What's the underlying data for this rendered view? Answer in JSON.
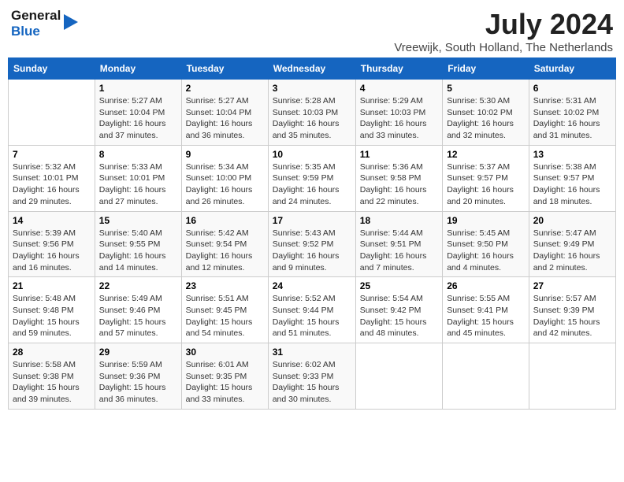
{
  "header": {
    "logo_line1": "General",
    "logo_line2": "Blue",
    "month": "July 2024",
    "location": "Vreewijk, South Holland, The Netherlands"
  },
  "days_of_week": [
    "Sunday",
    "Monday",
    "Tuesday",
    "Wednesday",
    "Thursday",
    "Friday",
    "Saturday"
  ],
  "weeks": [
    [
      {
        "num": "",
        "info": ""
      },
      {
        "num": "1",
        "info": "Sunrise: 5:27 AM\nSunset: 10:04 PM\nDaylight: 16 hours\nand 37 minutes."
      },
      {
        "num": "2",
        "info": "Sunrise: 5:27 AM\nSunset: 10:04 PM\nDaylight: 16 hours\nand 36 minutes."
      },
      {
        "num": "3",
        "info": "Sunrise: 5:28 AM\nSunset: 10:03 PM\nDaylight: 16 hours\nand 35 minutes."
      },
      {
        "num": "4",
        "info": "Sunrise: 5:29 AM\nSunset: 10:03 PM\nDaylight: 16 hours\nand 33 minutes."
      },
      {
        "num": "5",
        "info": "Sunrise: 5:30 AM\nSunset: 10:02 PM\nDaylight: 16 hours\nand 32 minutes."
      },
      {
        "num": "6",
        "info": "Sunrise: 5:31 AM\nSunset: 10:02 PM\nDaylight: 16 hours\nand 31 minutes."
      }
    ],
    [
      {
        "num": "7",
        "info": "Sunrise: 5:32 AM\nSunset: 10:01 PM\nDaylight: 16 hours\nand 29 minutes."
      },
      {
        "num": "8",
        "info": "Sunrise: 5:33 AM\nSunset: 10:01 PM\nDaylight: 16 hours\nand 27 minutes."
      },
      {
        "num": "9",
        "info": "Sunrise: 5:34 AM\nSunset: 10:00 PM\nDaylight: 16 hours\nand 26 minutes."
      },
      {
        "num": "10",
        "info": "Sunrise: 5:35 AM\nSunset: 9:59 PM\nDaylight: 16 hours\nand 24 minutes."
      },
      {
        "num": "11",
        "info": "Sunrise: 5:36 AM\nSunset: 9:58 PM\nDaylight: 16 hours\nand 22 minutes."
      },
      {
        "num": "12",
        "info": "Sunrise: 5:37 AM\nSunset: 9:57 PM\nDaylight: 16 hours\nand 20 minutes."
      },
      {
        "num": "13",
        "info": "Sunrise: 5:38 AM\nSunset: 9:57 PM\nDaylight: 16 hours\nand 18 minutes."
      }
    ],
    [
      {
        "num": "14",
        "info": "Sunrise: 5:39 AM\nSunset: 9:56 PM\nDaylight: 16 hours\nand 16 minutes."
      },
      {
        "num": "15",
        "info": "Sunrise: 5:40 AM\nSunset: 9:55 PM\nDaylight: 16 hours\nand 14 minutes."
      },
      {
        "num": "16",
        "info": "Sunrise: 5:42 AM\nSunset: 9:54 PM\nDaylight: 16 hours\nand 12 minutes."
      },
      {
        "num": "17",
        "info": "Sunrise: 5:43 AM\nSunset: 9:52 PM\nDaylight: 16 hours\nand 9 minutes."
      },
      {
        "num": "18",
        "info": "Sunrise: 5:44 AM\nSunset: 9:51 PM\nDaylight: 16 hours\nand 7 minutes."
      },
      {
        "num": "19",
        "info": "Sunrise: 5:45 AM\nSunset: 9:50 PM\nDaylight: 16 hours\nand 4 minutes."
      },
      {
        "num": "20",
        "info": "Sunrise: 5:47 AM\nSunset: 9:49 PM\nDaylight: 16 hours\nand 2 minutes."
      }
    ],
    [
      {
        "num": "21",
        "info": "Sunrise: 5:48 AM\nSunset: 9:48 PM\nDaylight: 15 hours\nand 59 minutes."
      },
      {
        "num": "22",
        "info": "Sunrise: 5:49 AM\nSunset: 9:46 PM\nDaylight: 15 hours\nand 57 minutes."
      },
      {
        "num": "23",
        "info": "Sunrise: 5:51 AM\nSunset: 9:45 PM\nDaylight: 15 hours\nand 54 minutes."
      },
      {
        "num": "24",
        "info": "Sunrise: 5:52 AM\nSunset: 9:44 PM\nDaylight: 15 hours\nand 51 minutes."
      },
      {
        "num": "25",
        "info": "Sunrise: 5:54 AM\nSunset: 9:42 PM\nDaylight: 15 hours\nand 48 minutes."
      },
      {
        "num": "26",
        "info": "Sunrise: 5:55 AM\nSunset: 9:41 PM\nDaylight: 15 hours\nand 45 minutes."
      },
      {
        "num": "27",
        "info": "Sunrise: 5:57 AM\nSunset: 9:39 PM\nDaylight: 15 hours\nand 42 minutes."
      }
    ],
    [
      {
        "num": "28",
        "info": "Sunrise: 5:58 AM\nSunset: 9:38 PM\nDaylight: 15 hours\nand 39 minutes."
      },
      {
        "num": "29",
        "info": "Sunrise: 5:59 AM\nSunset: 9:36 PM\nDaylight: 15 hours\nand 36 minutes."
      },
      {
        "num": "30",
        "info": "Sunrise: 6:01 AM\nSunset: 9:35 PM\nDaylight: 15 hours\nand 33 minutes."
      },
      {
        "num": "31",
        "info": "Sunrise: 6:02 AM\nSunset: 9:33 PM\nDaylight: 15 hours\nand 30 minutes."
      },
      {
        "num": "",
        "info": ""
      },
      {
        "num": "",
        "info": ""
      },
      {
        "num": "",
        "info": ""
      }
    ]
  ]
}
